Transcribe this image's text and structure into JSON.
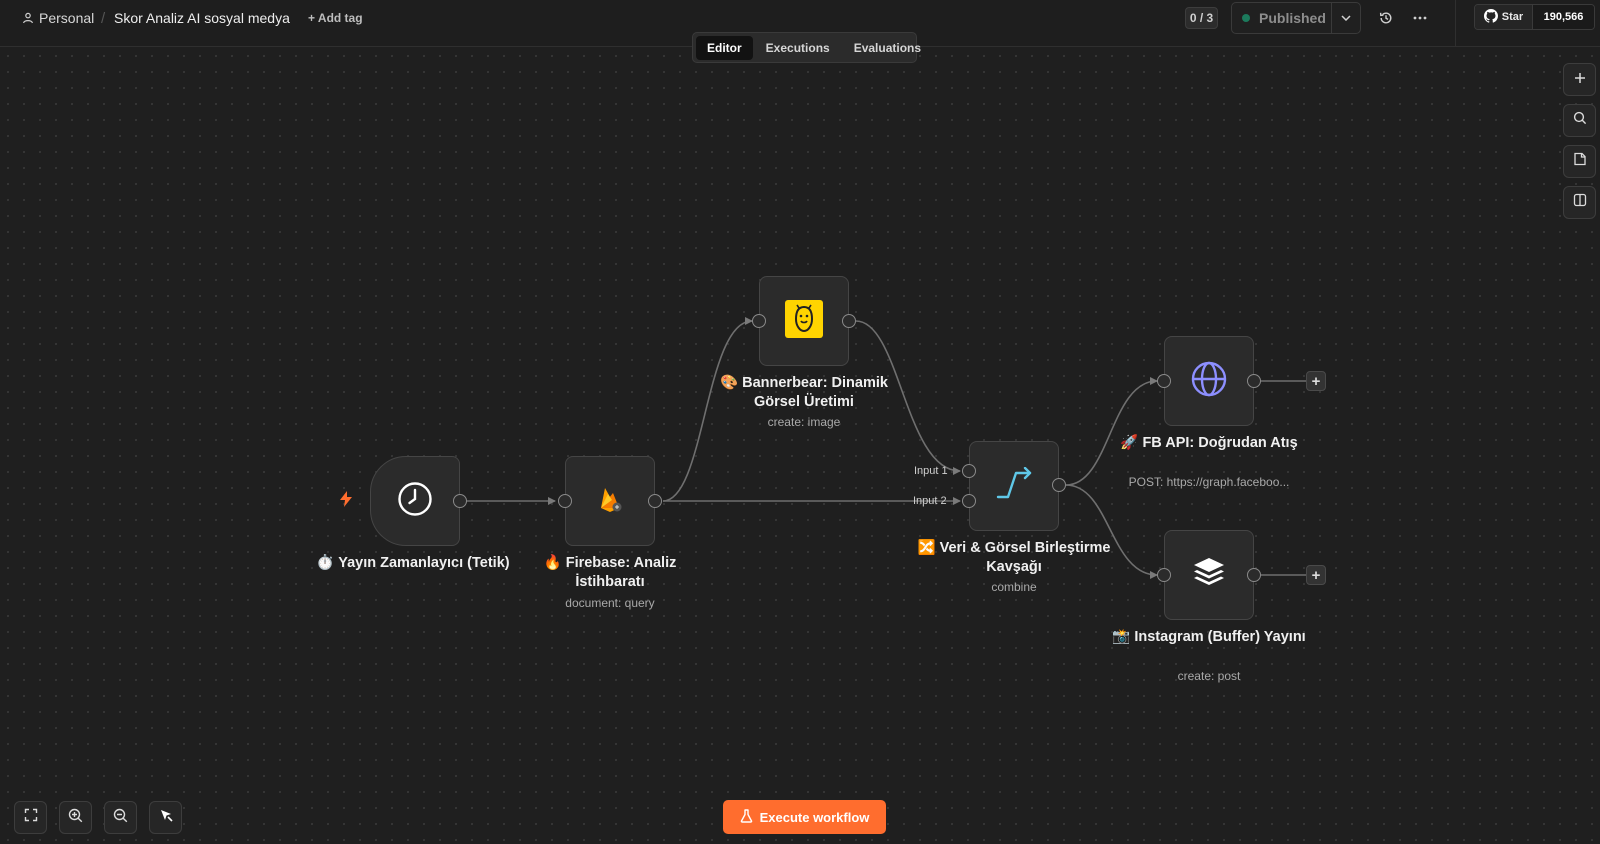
{
  "header": {
    "personal_label": "Personal",
    "separator": "/",
    "workflow_title": "Skor Analiz AI sosyal medya",
    "add_tag_label": "+ Add tag",
    "counter": "0 / 3",
    "published_label": "Published",
    "github_star_label": "Star",
    "github_star_count": "190,566"
  },
  "tabs": [
    {
      "label": "Editor",
      "active": true
    },
    {
      "label": "Executions",
      "active": false
    },
    {
      "label": "Evaluations",
      "active": false
    }
  ],
  "right_toolbar": [
    "plus-icon",
    "search-icon",
    "sticky-note-icon",
    "panel-icon"
  ],
  "nodes": {
    "trigger": {
      "title": "⏱️ Yayın Zamanlayıcı (Tetik)",
      "icon": "clock-icon"
    },
    "firebase": {
      "title": "🔥 Firebase: Analiz İstihbaratı",
      "subtitle": "document: query",
      "icon": "firebase-icon"
    },
    "bannerbear": {
      "title": "🎨 Bannerbear: Dinamik Görsel Üretimi",
      "subtitle": "create: image",
      "icon": "bannerbear-icon"
    },
    "merge": {
      "title": "🔀 Veri & Görsel Birleştirme Kavşağı",
      "subtitle": "combine",
      "icon": "merge-icon",
      "input1": "Input 1",
      "input2": "Input 2"
    },
    "fbapi": {
      "title": "🚀 FB API: Doğrudan Atış",
      "subtitle": "POST: https://graph.faceboo...",
      "icon": "globe-icon"
    },
    "instagram": {
      "title": "📸 Instagram (Buffer) Yayını",
      "subtitle": "create: post",
      "icon": "buffer-layers-icon"
    }
  },
  "bottom": {
    "execute_label": "Execute workflow"
  },
  "colors": {
    "canvas": "#1f1f1f",
    "accent": "#ff6d2e",
    "bannerbear_yellow": "#ffd400",
    "globe_blue": "#8d8fff",
    "merge_cyan": "#5fc8e8"
  }
}
